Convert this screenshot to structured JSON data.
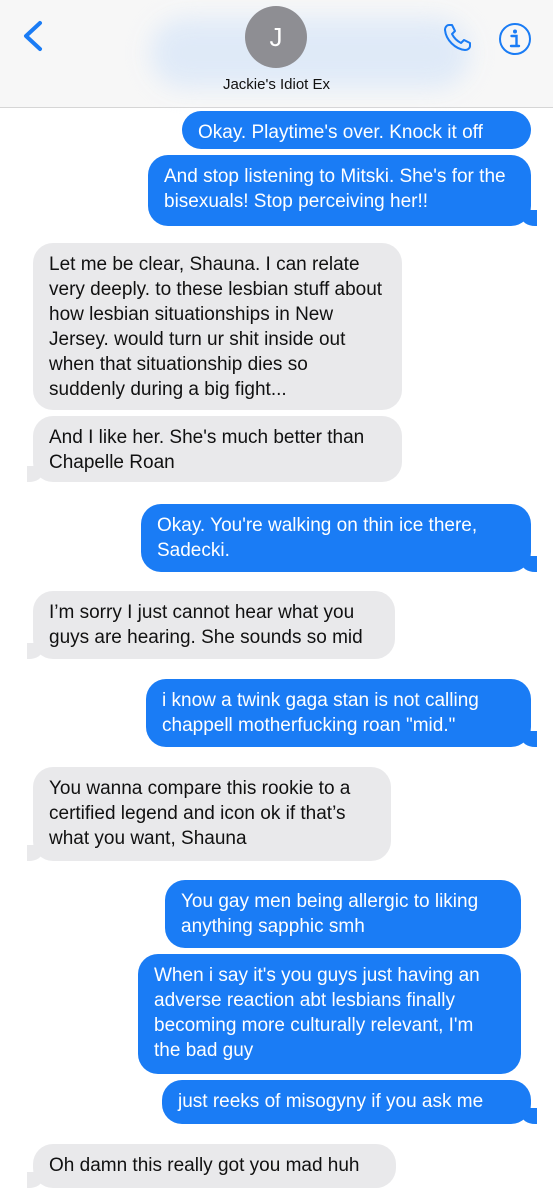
{
  "header": {
    "avatar_initial": "J",
    "contact_name": "Jackie's Idiot Ex"
  },
  "messages": [
    {
      "from": "me",
      "text": "Okay. Playtime's over. Knock it off"
    },
    {
      "from": "me",
      "text": "And stop listening to Mitski. She's for the bisexuals! Stop perceiving her!!"
    },
    {
      "from": "them",
      "text": "Let me be clear, Shauna. I can relate very deeply. to these lesbian stuff about how lesbian situationships in New Jersey. would turn ur shit inside out when that situationship dies so suddenly during a big fight..."
    },
    {
      "from": "them",
      "text": "And I like her. She's much better than Chapelle Roan"
    },
    {
      "from": "me",
      "text": "Okay. You're walking on thin ice there, Sadecki."
    },
    {
      "from": "them",
      "text": "I’m sorry I just cannot hear what you guys are hearing. She sounds so mid"
    },
    {
      "from": "me",
      "text": "i know a twink gaga stan is not calling chappell motherfucking roan \"mid.\""
    },
    {
      "from": "them",
      "text": "You wanna compare this rookie to a certified legend and icon ok if that’s what you want, Shauna"
    },
    {
      "from": "me",
      "text": "You gay men being allergic to liking anything sapphic smh"
    },
    {
      "from": "me",
      "text": "When i say it's you guys just having an adverse reaction abt lesbians finally becoming more culturally relevant, I'm the bad guy"
    },
    {
      "from": "me",
      "text": "just reeks of misogyny if you ask me"
    },
    {
      "from": "them",
      "text": "Oh damn this really got you mad huh"
    }
  ]
}
